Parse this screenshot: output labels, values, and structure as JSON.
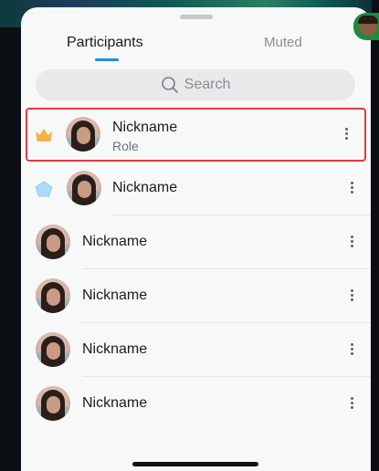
{
  "tabs": {
    "participants": "Participants",
    "muted": "Muted"
  },
  "search": {
    "placeholder": "Search"
  },
  "participants": [
    {
      "name": "Nickname",
      "role": "Role",
      "badge": "crown-icon"
    },
    {
      "name": "Nickname",
      "badge": "diamond-icon"
    },
    {
      "name": "Nickname"
    },
    {
      "name": "Nickname"
    },
    {
      "name": "Nickname"
    },
    {
      "name": "Nickname"
    }
  ],
  "colors": {
    "accent": "#1e8ee9",
    "crown": "#f5b14a",
    "diamond": "#a9dcf5",
    "highlight": "#e53a3a"
  }
}
